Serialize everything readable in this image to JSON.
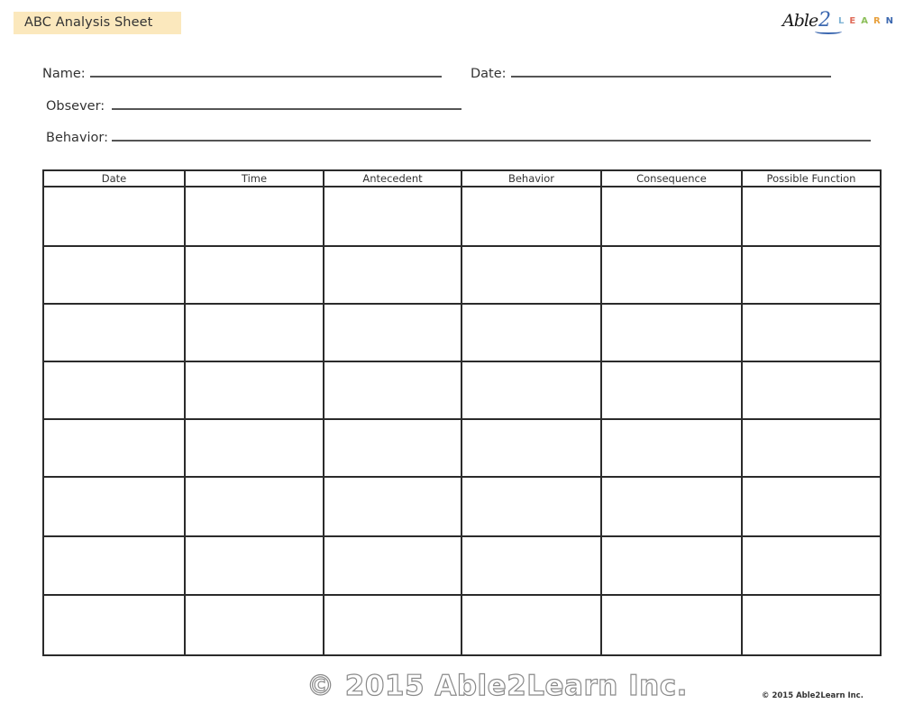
{
  "header": {
    "title": "ABC Analysis Sheet",
    "title_bg_color": "#fbe8bd",
    "logo": {
      "script_text": "Able",
      "numeral": "2",
      "letters": [
        {
          "char": "L",
          "color": "#7fb3d5"
        },
        {
          "char": "E",
          "color": "#e06c5a"
        },
        {
          "char": "A",
          "color": "#8cbf5a"
        },
        {
          "char": "R",
          "color": "#e8a03c"
        },
        {
          "char": "N",
          "color": "#3c68b0"
        }
      ]
    }
  },
  "form_fields": {
    "name": {
      "label": "Name:",
      "value": ""
    },
    "date": {
      "label": "Date:",
      "value": ""
    },
    "observer": {
      "label": "Obsever:",
      "value": ""
    },
    "behavior": {
      "label": "Behavior:",
      "value": ""
    }
  },
  "table": {
    "columns": [
      "Date",
      "Time",
      "Antecedent",
      "Behavior",
      "Consequence",
      "Possible Function"
    ],
    "rows": [
      [
        "",
        "",
        "",
        "",
        "",
        ""
      ],
      [
        "",
        "",
        "",
        "",
        "",
        ""
      ],
      [
        "",
        "",
        "",
        "",
        "",
        ""
      ],
      [
        "",
        "",
        "",
        "",
        "",
        ""
      ],
      [
        "",
        "",
        "",
        "",
        "",
        ""
      ],
      [
        "",
        "",
        "",
        "",
        "",
        ""
      ],
      [
        "",
        "",
        "",
        "",
        "",
        ""
      ],
      [
        "",
        "",
        "",
        "",
        "",
        ""
      ]
    ]
  },
  "footer": {
    "watermark": "© 2015 Able2Learn Inc.",
    "copyright": "© 2015 Able2Learn Inc."
  }
}
